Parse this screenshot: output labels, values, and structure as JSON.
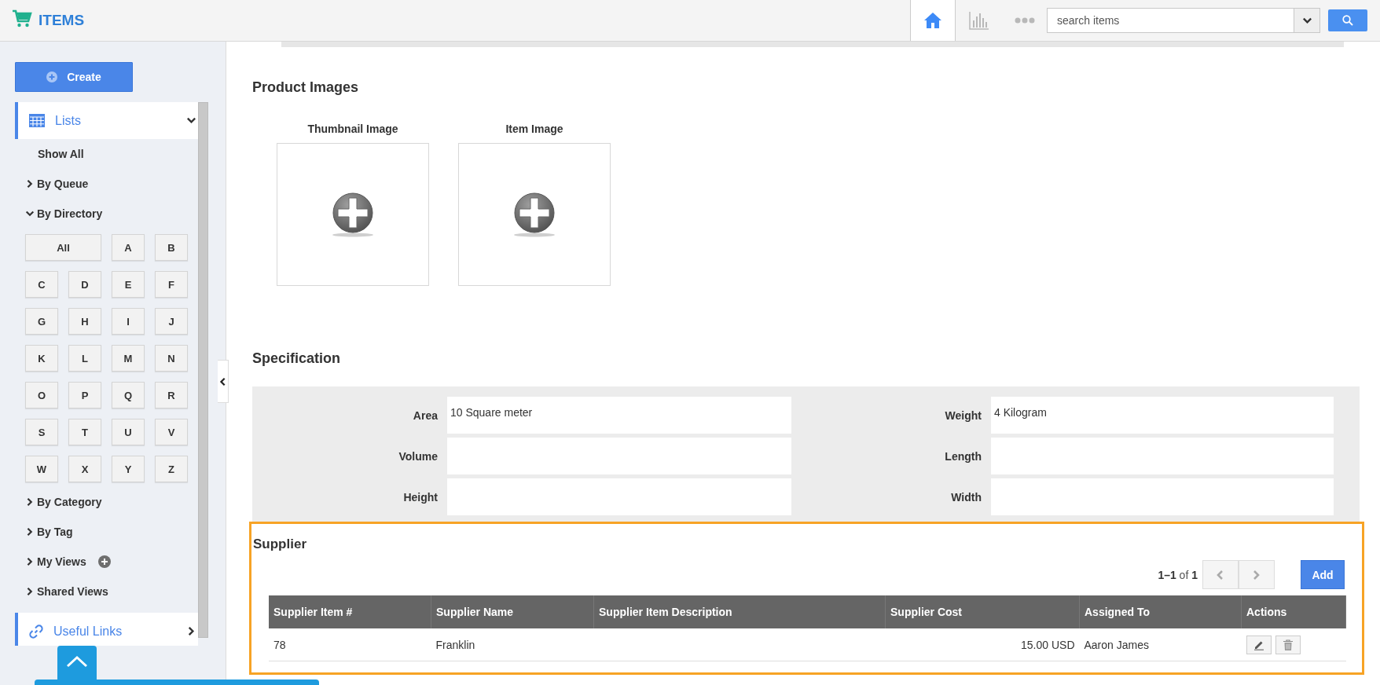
{
  "app": {
    "title": "ITEMS"
  },
  "top_nav": [
    {
      "kind": "home",
      "selected": true
    },
    {
      "kind": "chart",
      "selected": false
    },
    {
      "kind": "more",
      "selected": false
    }
  ],
  "search": {
    "placeholder": "search items"
  },
  "sidebar": {
    "create_label": "Create",
    "panels": [
      {
        "label": "Lists",
        "kind": "calendar",
        "expanded": true
      },
      {
        "label": "Useful Links",
        "kind": "link",
        "expanded": false
      }
    ],
    "items_before": [
      {
        "label": "Show All",
        "kind": "plain"
      },
      {
        "label": "By Queue",
        "kind": "toggle",
        "expanded": false
      },
      {
        "label": "By Directory",
        "kind": "toggle",
        "expanded": true
      }
    ],
    "letters": [
      "All",
      "A",
      "B",
      "C",
      "D",
      "E",
      "F",
      "G",
      "H",
      "I",
      "J",
      "K",
      "L",
      "M",
      "N",
      "O",
      "P",
      "Q",
      "R",
      "S",
      "T",
      "U",
      "V",
      "W",
      "X",
      "Y",
      "Z"
    ],
    "items_after": [
      {
        "label": "By Category",
        "kind": "toggle",
        "expanded": false
      },
      {
        "label": "By Tag",
        "kind": "toggle",
        "expanded": false
      },
      {
        "label": "My Views",
        "kind": "addable",
        "expanded": false
      },
      {
        "label": "Shared Views",
        "kind": "toggle",
        "expanded": false
      }
    ]
  },
  "product_images": {
    "title": "Product Images",
    "slots": [
      {
        "label": "Thumbnail Image"
      },
      {
        "label": "Item Image"
      }
    ]
  },
  "specification": {
    "title": "Specification",
    "fields": [
      {
        "label": "Area",
        "value": "10 Square meter"
      },
      {
        "label": "Weight",
        "value": "4 Kilogram"
      },
      {
        "label": "Volume"
      },
      {
        "label": "Length"
      },
      {
        "label": "Height"
      },
      {
        "label": "Width"
      }
    ]
  },
  "supplier": {
    "title": "Supplier",
    "pager": "**1–1** of **1**",
    "add_label": "Add",
    "table": {
      "columns": [
        {
          "label": "Supplier Item #"
        },
        {
          "label": "Supplier Name"
        },
        {
          "label": "Supplier Item Description"
        },
        {
          "label": "Supplier Cost"
        },
        {
          "label": "Assigned To"
        },
        {
          "label": "Actions"
        }
      ],
      "rows": [
        {
          "cells": [
            "78",
            "Franklin",
            "",
            "15.00 USD",
            "Aaron James"
          ]
        }
      ]
    }
  }
}
